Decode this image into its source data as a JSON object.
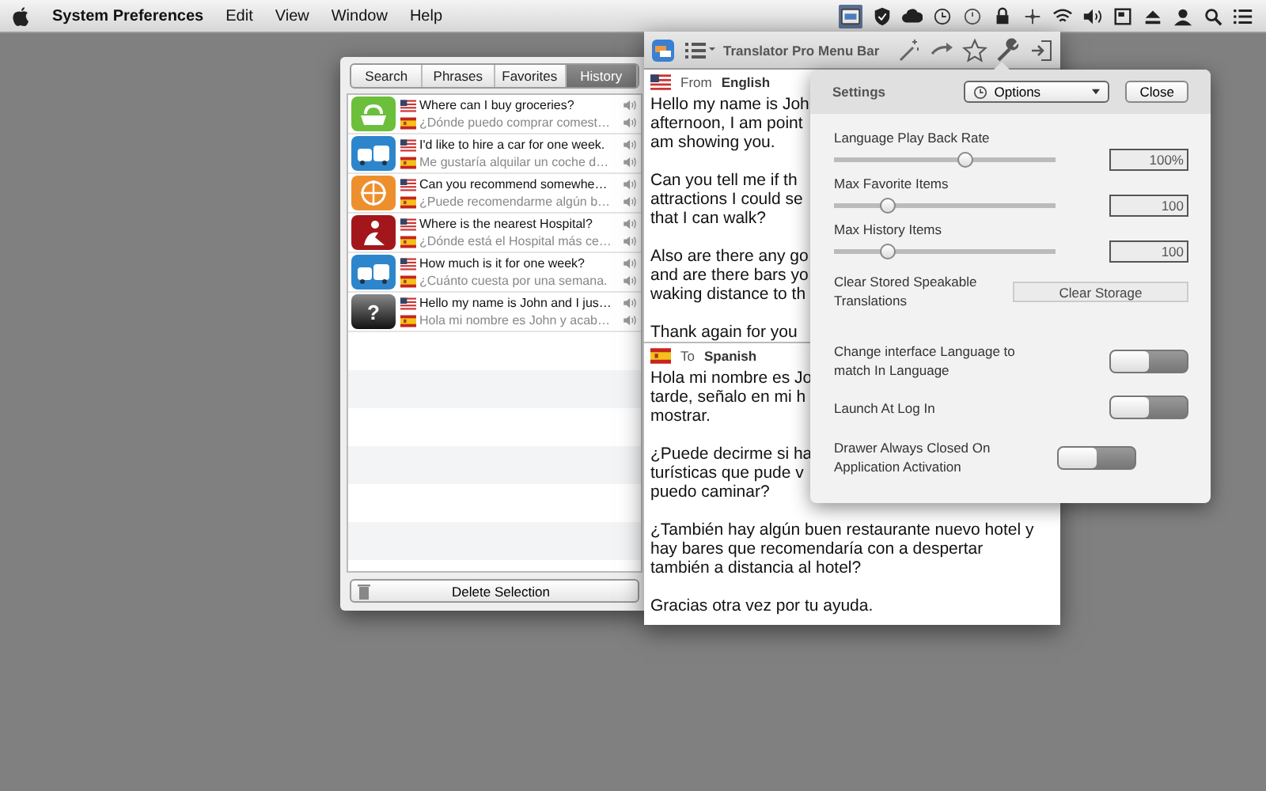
{
  "menu_bar": {
    "app_name": "System Preferences",
    "menus": [
      "Edit",
      "View",
      "Window",
      "Help"
    ]
  },
  "history_window": {
    "tabs": [
      {
        "label": "Search",
        "selected": false
      },
      {
        "label": "Phrases",
        "selected": false
      },
      {
        "label": "Favorites",
        "selected": false
      },
      {
        "label": "History",
        "selected": true
      }
    ],
    "items": [
      {
        "kind": "grocery",
        "phrase": "Where can I buy groceries?",
        "translation": "¿Dónde puedo comprar comest…"
      },
      {
        "kind": "transport",
        "phrase": "I'd like to hire a car for one week.",
        "translation": "Me gustaría alquilar un coche d…"
      },
      {
        "kind": "places",
        "phrase": "Can you recommend somewhe…",
        "translation": "¿Puede recomendarme algún b…"
      },
      {
        "kind": "medical",
        "phrase": "Where is the nearest Hospital?",
        "translation": "¿Dónde está el Hospital más ce…"
      },
      {
        "kind": "transport",
        "phrase": "How much is it for one week?",
        "translation": "¿Cuánto cuesta por una semana."
      },
      {
        "kind": "general",
        "icon_text": "?",
        "phrase": "Hello my name is John and I jus…",
        "translation": "Hola mi nombre es John y acab…"
      }
    ],
    "delete_button": "Delete Selection"
  },
  "translator": {
    "title": "Translator Pro Menu Bar",
    "source": {
      "prefix": "From",
      "language": "English",
      "paragraphs": [
        [
          "Hello my name is Joh",
          "afternoon, I am point",
          "am showing you."
        ],
        [
          "Can you tell me if th",
          "attractions I could se",
          "that I can walk?"
        ],
        [
          "Also are there any go",
          "and are there bars yo",
          "waking distance to th"
        ],
        [
          "Thank again for you"
        ]
      ]
    },
    "target": {
      "prefix": "To",
      "language": "Spanish",
      "paragraphs": [
        [
          "Hola mi nombre es Jo",
          "tarde, señalo en mi h",
          "mostrar."
        ],
        [
          "¿Puede decirme si ha",
          "turísticas que pude v",
          "puedo caminar?"
        ],
        [
          "¿También hay algún buen restaurante nuevo hotel y",
          "hay bares que recomendaría con a despertar",
          "también a distancia al hotel?"
        ],
        [
          "Gracias otra vez por tu ayuda."
        ]
      ]
    }
  },
  "settings": {
    "title": "Settings",
    "mode_dropdown": "Options",
    "close_button": "Close",
    "sliders": [
      {
        "label": "Language Play Back Rate",
        "level": 0.59,
        "value": "100%"
      },
      {
        "label": "Max Favorite Items",
        "level": 0.24,
        "value": "100"
      },
      {
        "label": "Max History Items",
        "level": 0.24,
        "value": "100"
      }
    ],
    "clear": {
      "label": "Clear Stored Speakable Translations",
      "button": "Clear Storage"
    },
    "toggles": [
      {
        "label": "Change interface Language to match In Language",
        "on": false
      },
      {
        "label": "Launch At Log In",
        "on": false
      },
      {
        "label": "Drawer Always Closed On Application Activation",
        "on": false
      }
    ]
  }
}
